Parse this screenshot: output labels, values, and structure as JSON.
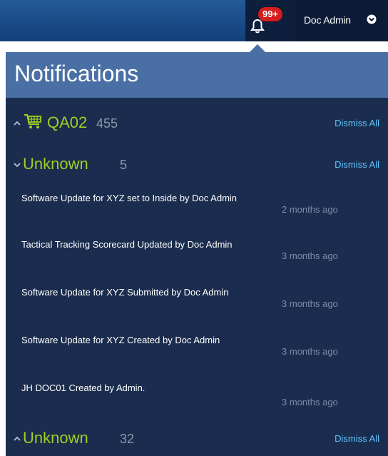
{
  "header": {
    "badge": "99+",
    "user_name": "Doc Admin"
  },
  "panel": {
    "title": "Notifications",
    "groups": [
      {
        "name": "QA02",
        "count": "455",
        "expanded": false,
        "icon": "cart-icon",
        "dismiss_label": "Dismiss All"
      },
      {
        "name": "Unknown",
        "count": "5",
        "expanded": true,
        "dismiss_label": "Dismiss All",
        "items": [
          {
            "text": "Software Update for XYZ set to Inside by Doc Admin",
            "time": "2 months ago"
          },
          {
            "text": "Tactical Tracking Scorecard Updated by Doc Admin",
            "time": "3 months ago"
          },
          {
            "text": "Software Update for XYZ Submitted by Doc Admin",
            "time": "3 months ago"
          },
          {
            "text": "Software Update for XYZ Created by Doc Admin",
            "time": "3 months ago"
          },
          {
            "text": "JH DOC01 Created by  Admin.",
            "time": "3 months ago"
          }
        ]
      },
      {
        "name": "Unknown",
        "count": "32",
        "expanded": false,
        "dismiss_label": "Dismiss All"
      }
    ]
  },
  "colors": {
    "topbar": "#1a4a86",
    "panel_bg": "#1b2d4e",
    "panel_header": "#4a6fa5",
    "group_name": "#9fcf22",
    "dismiss": "#5ec3ff",
    "badge": "#d41d1d"
  },
  "icons": [
    "bell-icon",
    "chevron-down-circle-icon",
    "cart-icon",
    "chevron-up-icon",
    "chevron-down-icon"
  ]
}
